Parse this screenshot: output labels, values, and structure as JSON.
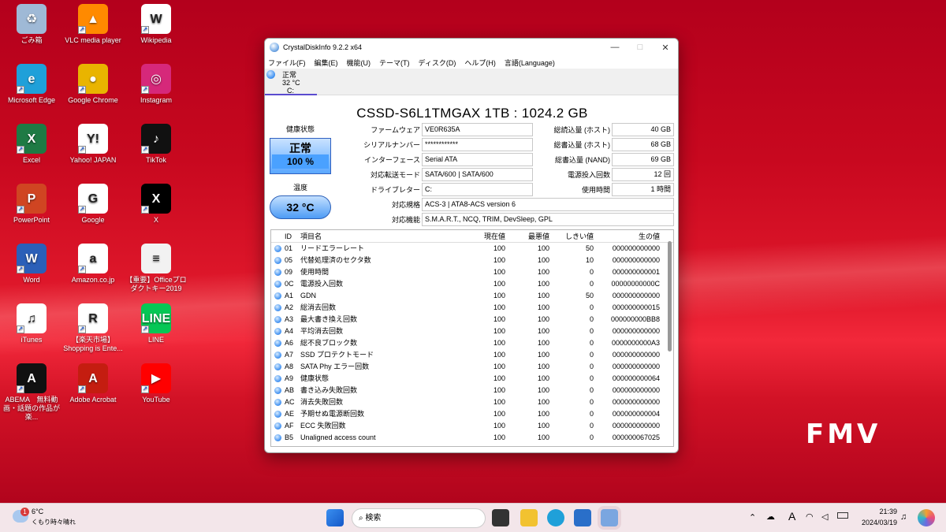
{
  "desktop": {
    "icons": [
      {
        "label": "ごみ箱",
        "glyph": "♻",
        "bg": "#9fb9d6",
        "shortcut": false
      },
      {
        "label": "VLC media player",
        "glyph": "▲",
        "bg": "#ff8a00",
        "shortcut": true
      },
      {
        "label": "Wikipedia",
        "glyph": "W",
        "bg": "#ffffff",
        "shortcut": true
      },
      {
        "label": "Microsoft Edge",
        "glyph": "e",
        "bg": "#1fa0d9",
        "shortcut": true
      },
      {
        "label": "Google Chrome",
        "glyph": "●",
        "bg": "#e9b400",
        "shortcut": true
      },
      {
        "label": "Instagram",
        "glyph": "◎",
        "bg": "#d6287a",
        "shortcut": true
      },
      {
        "label": "Excel",
        "glyph": "X",
        "bg": "#1e7a44",
        "shortcut": true
      },
      {
        "label": "Yahoo! JAPAN",
        "glyph": "Y!",
        "bg": "#ffffff",
        "shortcut": true
      },
      {
        "label": "TikTok",
        "glyph": "♪",
        "bg": "#111111",
        "shortcut": true
      },
      {
        "label": "PowerPoint",
        "glyph": "P",
        "bg": "#d04522",
        "shortcut": true
      },
      {
        "label": "Google",
        "glyph": "G",
        "bg": "#ffffff",
        "shortcut": true
      },
      {
        "label": "X",
        "glyph": "X",
        "bg": "#000000",
        "shortcut": true
      },
      {
        "label": "Word",
        "glyph": "W",
        "bg": "#2b5fb8",
        "shortcut": true
      },
      {
        "label": "Amazon.co.jp",
        "glyph": "a",
        "bg": "#ffffff",
        "shortcut": true
      },
      {
        "label": "【重要】Officeプロダクトキー2019",
        "glyph": "≡",
        "bg": "#f2f2f2",
        "shortcut": false
      },
      {
        "label": "iTunes",
        "glyph": "♫",
        "bg": "#ffffff",
        "shortcut": true
      },
      {
        "label": "【楽天市場】Shopping is Ente...",
        "glyph": "R",
        "bg": "#ffffff",
        "shortcut": true
      },
      {
        "label": "LINE",
        "glyph": "LINE",
        "bg": "#06c755",
        "shortcut": true
      },
      {
        "label": "ABEMA　無料動画・話題の作品が楽...",
        "glyph": "A",
        "bg": "#111111",
        "shortcut": true
      },
      {
        "label": "Adobe Acrobat",
        "glyph": "A",
        "bg": "#c41d10",
        "shortcut": true
      },
      {
        "label": "YouTube",
        "glyph": "▶",
        "bg": "#ff0000",
        "shortcut": true
      }
    ],
    "brand": "FMV"
  },
  "window": {
    "title": "CrystalDiskInfo 9.2.2 x64",
    "controls": {
      "minimize": "—",
      "maximize": "□",
      "close": "✕"
    },
    "menu": [
      "ファイル(F)",
      "編集(E)",
      "機能(U)",
      "テーマ(T)",
      "ディスク(D)",
      "ヘルプ(H)",
      "言語(Language)"
    ],
    "drive_tab": {
      "status": "正常",
      "temp": "32 °C",
      "letter": "C:"
    },
    "model": "CSSD-S6L1TMGAX 1TB : 1024.2 GB",
    "health_label": "健康状態",
    "health_status": "正常",
    "health_percent": "100 %",
    "temp_label": "温度",
    "temp_value": "32 °C",
    "info_left": [
      {
        "label": "ファームウェア",
        "value": "VE0R635A"
      },
      {
        "label": "シリアルナンバー",
        "value": "************"
      },
      {
        "label": "インターフェース",
        "value": "Serial ATA"
      },
      {
        "label": "対応転送モード",
        "value": "SATA/600 | SATA/600"
      },
      {
        "label": "ドライブレター",
        "value": "C:"
      }
    ],
    "info_right": [
      {
        "label": "総読込量 (ホスト)",
        "value": "40 GB"
      },
      {
        "label": "総書込量 (ホスト)",
        "value": "68 GB"
      },
      {
        "label": "総書込量 (NAND)",
        "value": "69 GB"
      },
      {
        "label": "電源投入回数",
        "value": "12 回"
      },
      {
        "label": "使用時間",
        "value": "1 時間"
      }
    ],
    "standard": {
      "label": "対応規格",
      "value": "ACS-3 | ATA8-ACS version 6"
    },
    "features": {
      "label": "対応機能",
      "value": "S.M.A.R.T., NCQ, TRIM, DevSleep, GPL"
    },
    "smart_headers": [
      "ID",
      "項目名",
      "現在値",
      "最悪値",
      "しきい値",
      "生の値"
    ],
    "smart_rows": [
      [
        "01",
        "リードエラーレート",
        "100",
        "100",
        "50",
        "000000000000"
      ],
      [
        "05",
        "代替処理済のセクタ数",
        "100",
        "100",
        "10",
        "000000000000"
      ],
      [
        "09",
        "使用時間",
        "100",
        "100",
        "0",
        "000000000001"
      ],
      [
        "0C",
        "電源投入回数",
        "100",
        "100",
        "0",
        "00000000000C"
      ],
      [
        "A1",
        "GDN",
        "100",
        "100",
        "50",
        "000000000000"
      ],
      [
        "A2",
        "総消去回数",
        "100",
        "100",
        "0",
        "000000000015"
      ],
      [
        "A3",
        "最大書き換え回数",
        "100",
        "100",
        "0",
        "000000000BB8"
      ],
      [
        "A4",
        "平均消去回数",
        "100",
        "100",
        "0",
        "000000000000"
      ],
      [
        "A6",
        "総不良ブロック数",
        "100",
        "100",
        "0",
        "0000000000A3"
      ],
      [
        "A7",
        "SSD プロテクトモード",
        "100",
        "100",
        "0",
        "000000000000"
      ],
      [
        "A8",
        "SATA Phy エラー回数",
        "100",
        "100",
        "0",
        "000000000000"
      ],
      [
        "A9",
        "健康状態",
        "100",
        "100",
        "0",
        "000000000064"
      ],
      [
        "AB",
        "書き込み失敗回数",
        "100",
        "100",
        "0",
        "000000000000"
      ],
      [
        "AC",
        "消去失敗回数",
        "100",
        "100",
        "0",
        "000000000000"
      ],
      [
        "AE",
        "予期せぬ電源断回数",
        "100",
        "100",
        "0",
        "000000000004"
      ],
      [
        "AF",
        "ECC 失敗回数",
        "100",
        "100",
        "0",
        "000000000000"
      ],
      [
        "B5",
        "Unaligned access count",
        "100",
        "100",
        "0",
        "000000067025"
      ]
    ]
  },
  "taskbar": {
    "weather_temp": "6°C",
    "weather_text": "くもり時々晴れ",
    "weather_badge": "1",
    "search_placeholder": "検索",
    "ime": "A",
    "time": "21:39",
    "date": "2024/03/19"
  }
}
